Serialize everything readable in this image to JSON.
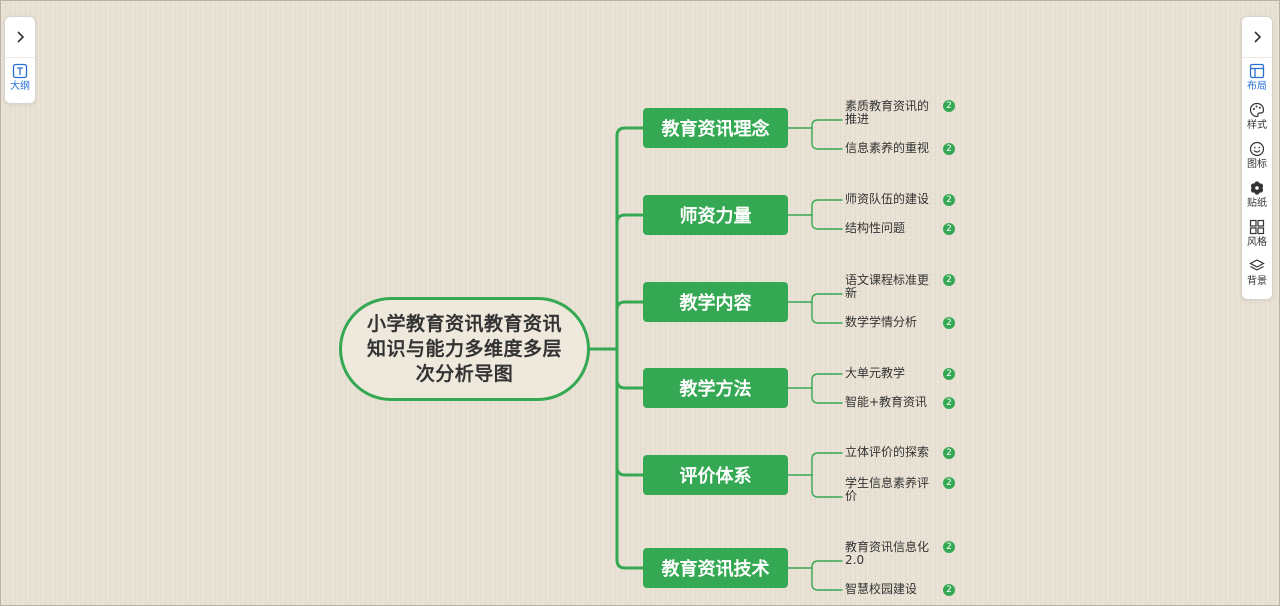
{
  "left_panel": {
    "toggle_icon": "chevron-right-icon",
    "items": [
      {
        "label": "大纲",
        "icon": "outline-icon",
        "active": true
      }
    ]
  },
  "right_panel": {
    "toggle_icon": "chevron-right-icon",
    "items": [
      {
        "label": "布局",
        "icon": "layout-icon",
        "active": true
      },
      {
        "label": "样式",
        "icon": "palette-icon",
        "active": false
      },
      {
        "label": "图标",
        "icon": "smiley-icon",
        "active": false
      },
      {
        "label": "贴纸",
        "icon": "flower-icon",
        "active": false
      },
      {
        "label": "风格",
        "icon": "grid-icon",
        "active": false
      },
      {
        "label": "背景",
        "icon": "layers-icon",
        "active": false
      }
    ]
  },
  "mindmap": {
    "central_topic": "小学教育资讯教育资讯知识与能力多维度多层次分析导图",
    "accent_color": "#35a853",
    "branches": [
      {
        "label": "教育资讯理念",
        "children": [
          {
            "label": "素质教育资讯的推进",
            "badge": "2"
          },
          {
            "label": "信息素养的重视",
            "badge": "2"
          }
        ]
      },
      {
        "label": "师资力量",
        "children": [
          {
            "label": "师资队伍的建设",
            "badge": "2"
          },
          {
            "label": "结构性问题",
            "badge": "2"
          }
        ]
      },
      {
        "label": "教学内容",
        "children": [
          {
            "label": "语文课程标准更新",
            "badge": "2"
          },
          {
            "label": "数学学情分析",
            "badge": "2"
          }
        ]
      },
      {
        "label": "教学方法",
        "children": [
          {
            "label": "大单元教学",
            "badge": "2"
          },
          {
            "label": "智能+教育资讯",
            "badge": "2"
          }
        ]
      },
      {
        "label": "评价体系",
        "children": [
          {
            "label": "立体评价的探索",
            "badge": "2"
          },
          {
            "label": "学生信息素养评价",
            "badge": "2"
          }
        ]
      },
      {
        "label": "教育资讯技术",
        "children": [
          {
            "label": "教育资讯信息化2.0",
            "badge": "2"
          },
          {
            "label": "智慧校园建设",
            "badge": "2"
          }
        ]
      }
    ]
  }
}
